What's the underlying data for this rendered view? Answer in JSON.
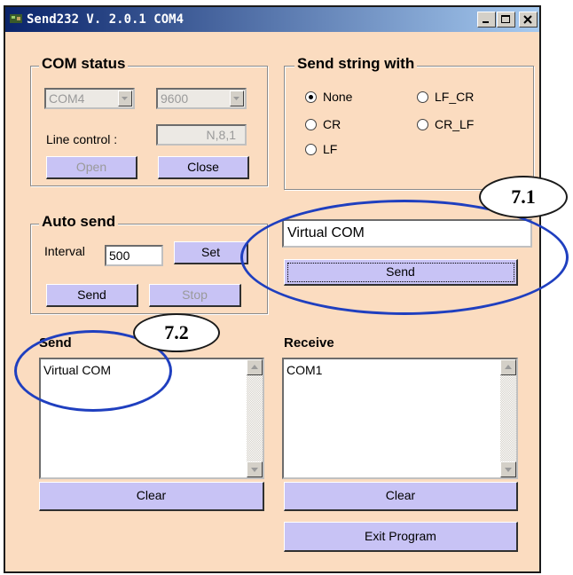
{
  "window": {
    "title": "Send232 V. 2.0.1 COM4",
    "bg_color": "#fbdcc0",
    "title_buttons": [
      "minimize-icon",
      "maximize-icon",
      "close-icon"
    ]
  },
  "com_status": {
    "title": "COM status",
    "port": "COM4",
    "baud": "9600",
    "line_control_label": "Line control :",
    "line_control_value": "N,8,1",
    "open_label": "Open",
    "close_label": "Close"
  },
  "send_string_with": {
    "title": "Send string with",
    "options": [
      {
        "label": "None",
        "selected": true
      },
      {
        "label": "LF_CR",
        "selected": false
      },
      {
        "label": "CR",
        "selected": false
      },
      {
        "label": "CR_LF",
        "selected": false
      },
      {
        "label": "LF",
        "selected": false
      }
    ]
  },
  "auto_send": {
    "title": "Auto send",
    "interval_label": "Interval",
    "interval_value": "500",
    "set_label": "Set",
    "send_label": "Send",
    "stop_label": "Stop"
  },
  "manual_send": {
    "input_value": "Virtual COM",
    "send_label": "Send"
  },
  "send_panel": {
    "title": "Send",
    "content": "Virtual COM",
    "clear_label": "Clear"
  },
  "receive_panel": {
    "title": "Receive",
    "content": "COM1",
    "clear_label": "Clear"
  },
  "exit_label": "Exit Program",
  "annotations": {
    "tag_1": "7.1",
    "tag_2": "7.2",
    "color": "#1f3fbf"
  },
  "button_color": "#c8c3f5"
}
